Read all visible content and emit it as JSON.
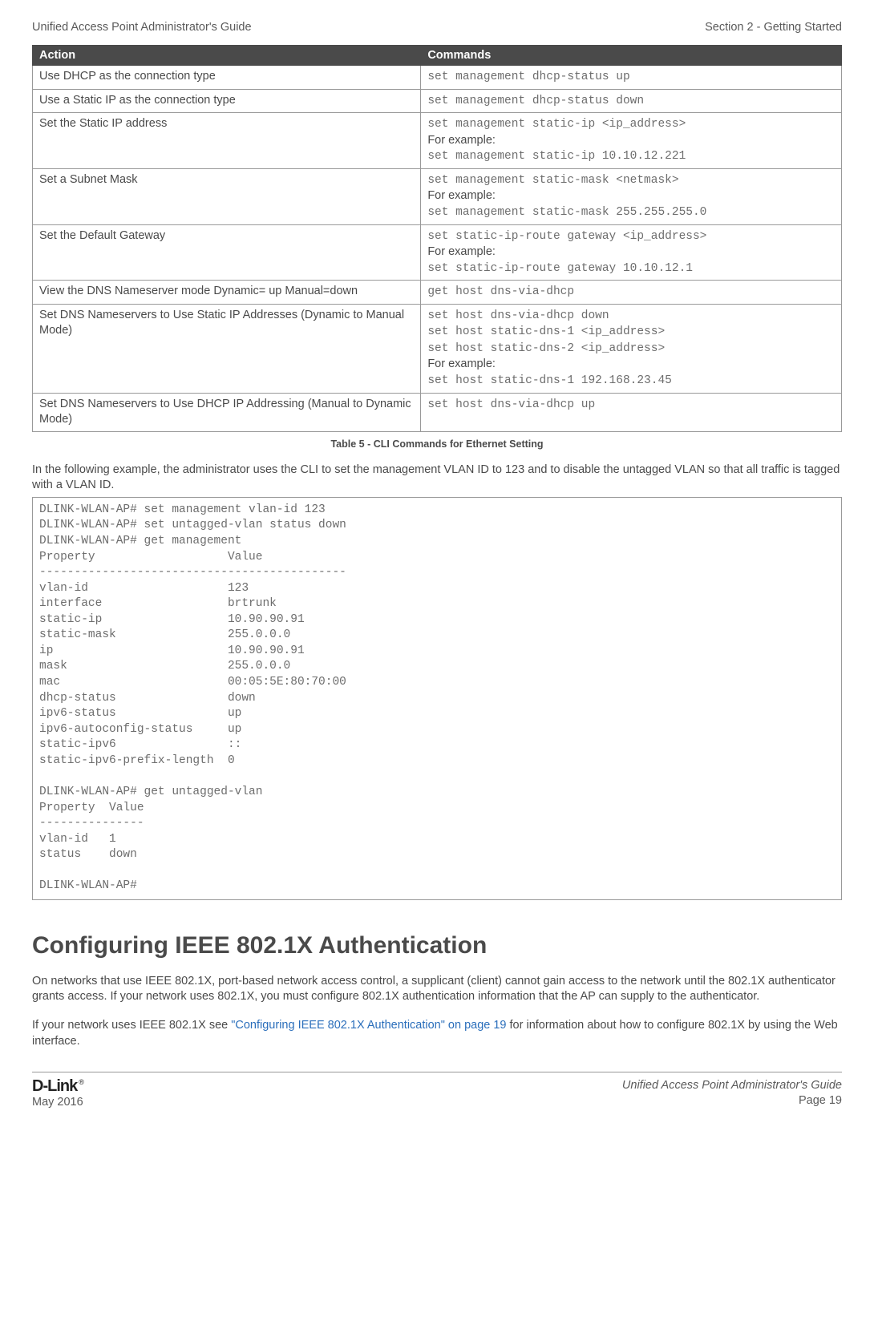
{
  "header": {
    "left": "Unified Access Point Administrator's Guide",
    "right": "Section 2 - Getting Started"
  },
  "table": {
    "headers": {
      "action": "Action",
      "commands": "Commands"
    },
    "rows": [
      {
        "action": "Use DHCP as the connection type",
        "cmd1": "set management dhcp-status up"
      },
      {
        "action": "Use a Static IP as the connection type",
        "cmd1": "set management dhcp-status down"
      },
      {
        "action": "Set the Static IP address",
        "cmd1": "set management static-ip <ip_address>",
        "note": "For example:",
        "cmd2": "set management static-ip 10.10.12.221"
      },
      {
        "action": "Set a Subnet Mask",
        "cmd1": "set management static-mask <netmask>",
        "note": "For example:",
        "cmd2": "set management static-mask 255.255.255.0"
      },
      {
        "action": "Set the Default Gateway",
        "cmd1": "set static-ip-route gateway <ip_address>",
        "note": "For example:",
        "cmd2": "set static-ip-route gateway 10.10.12.1"
      },
      {
        "action": "View the DNS Nameserver mode Dynamic= up Manual=down",
        "cmd1": "get host dns-via-dhcp"
      },
      {
        "action": "Set DNS Nameservers to Use Static IP Addresses (Dynamic to Manual Mode)",
        "cmd1": "set host dns-via-dhcp down",
        "cmd1b": "set host static-dns-1 <ip_address>",
        "cmd1c": "set host static-dns-2 <ip_address>",
        "note": "For example:",
        "cmd2": "set host static-dns-1 192.168.23.45"
      },
      {
        "action": "Set DNS Nameservers to Use DHCP IP Addressing (Manual to Dynamic Mode)",
        "cmd1": "set host dns-via-dhcp up"
      }
    ],
    "caption": "Table 5 - CLI Commands for Ethernet Setting"
  },
  "intro_para": "In the following example, the administrator uses the CLI to set the management VLAN ID to 123 and to disable the untagged VLAN so that all traffic is tagged with a VLAN ID.",
  "cli_block": "DLINK-WLAN-AP# set management vlan-id 123\nDLINK-WLAN-AP# set untagged-vlan status down\nDLINK-WLAN-AP# get management\nProperty                   Value\n--------------------------------------------\nvlan-id                    123\ninterface                  brtrunk\nstatic-ip                  10.90.90.91\nstatic-mask                255.0.0.0\nip                         10.90.90.91\nmask                       255.0.0.0\nmac                        00:05:5E:80:70:00\ndhcp-status                down\nipv6-status                up\nipv6-autoconfig-status     up\nstatic-ipv6                ::\nstatic-ipv6-prefix-length  0\n\nDLINK-WLAN-AP# get untagged-vlan\nProperty  Value\n---------------\nvlan-id   1\nstatus    down\n\nDLINK-WLAN-AP#",
  "section": {
    "heading": "Configuring IEEE 802.1X Authentication",
    "p1": "On networks that use IEEE 802.1X, port-based network access control, a supplicant (client) cannot gain access to the network until the 802.1X authenticator grants access. If your network uses 802.1X, you must configure 802.1X authentication information that the AP can supply to the authenticator.",
    "p2a": "If your network uses IEEE 802.1X see ",
    "p2link": "\"Configuring IEEE 802.1X Authentication\" on page 19",
    "p2b": " for information about how to configure 802.1X by using the Web interface."
  },
  "footer": {
    "logo": "D-Link",
    "date": "May 2016",
    "right1": "Unified Access Point Administrator's Guide",
    "right2": "Page 19"
  }
}
